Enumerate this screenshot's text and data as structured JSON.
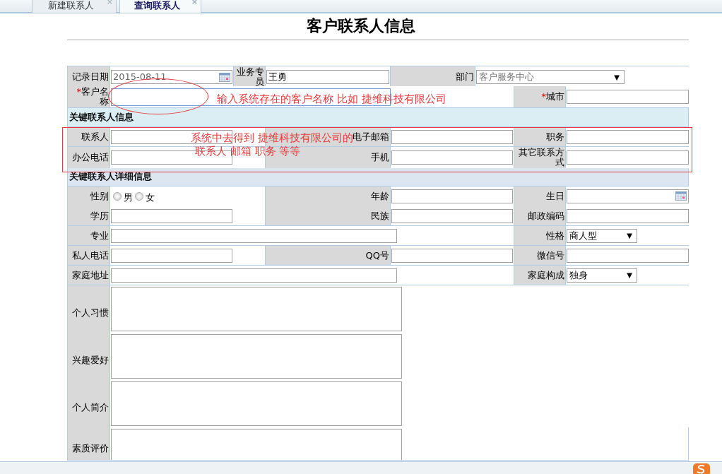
{
  "tabs": [
    {
      "label": "新建联系人",
      "selected": false,
      "close": "×"
    },
    {
      "label": "查询联系人",
      "selected": true,
      "close": "×"
    }
  ],
  "title": "客户联系人信息",
  "rows": [
    {
      "kind": "top",
      "cells": [
        {
          "label": "记录日期",
          "control": {
            "kind": "date",
            "value": "2015-08-11"
          }
        },
        {
          "label": "业务专员",
          "control": {
            "kind": "text",
            "value": "王勇"
          }
        },
        {
          "label": "部门",
          "control": {
            "kind": "select",
            "value": "客户服务中心",
            "caret": "▼",
            "disabled": true
          }
        }
      ]
    },
    {
      "kind": "fields",
      "cells": [
        {
          "label": "客户名称",
          "marker": "*",
          "control": {
            "kind": "text",
            "focused": true
          }
        },
        {
          "label": "城市",
          "marker": "*",
          "control": {
            "kind": "text"
          }
        }
      ]
    },
    {
      "kind": "section",
      "title": "关键联系人信息"
    },
    {
      "kind": "fields",
      "cells": [
        {
          "label": "联系人",
          "control": {
            "kind": "text"
          }
        },
        {
          "label": "电子邮箱",
          "control": {
            "kind": "text"
          }
        },
        {
          "label": "职务",
          "control": {
            "kind": "text"
          }
        }
      ]
    },
    {
      "kind": "fields",
      "cells": [
        {
          "label": "办公电话",
          "control": {
            "kind": "text"
          }
        },
        {
          "label": "手机",
          "control": {
            "kind": "text"
          }
        },
        {
          "label": "其它联系方式",
          "control": {
            "kind": "text"
          }
        }
      ]
    },
    {
      "kind": "section",
      "title": "关键联系人详细信息"
    },
    {
      "kind": "fields",
      "cells": [
        {
          "label": "性别",
          "control": {
            "kind": "radio",
            "options": [
              {
                "label": "男",
                "selected": false
              },
              {
                "label": "女",
                "selected": false
              }
            ]
          }
        },
        {
          "label": "年龄",
          "control": {
            "kind": "text"
          }
        },
        {
          "label": "生日",
          "control": {
            "kind": "date"
          }
        }
      ]
    },
    {
      "kind": "fields",
      "cells": [
        {
          "label": "学历",
          "control": {
            "kind": "text"
          }
        },
        {
          "label": "民族",
          "control": {
            "kind": "text"
          }
        },
        {
          "label": "邮政编码",
          "control": {
            "kind": "text"
          }
        }
      ]
    },
    {
      "kind": "fields",
      "cells": [
        {
          "label": "专业",
          "control": {
            "kind": "text"
          }
        },
        {
          "label": "性格",
          "control": {
            "kind": "select",
            "value": "商人型",
            "caret": "▼",
            "disabled": false
          }
        }
      ]
    },
    {
      "kind": "fields",
      "cells": [
        {
          "label": "私人电话",
          "control": {
            "kind": "text"
          }
        },
        {
          "label": "QQ号",
          "control": {
            "kind": "text"
          }
        },
        {
          "label": "微信号",
          "control": {
            "kind": "text"
          }
        }
      ]
    },
    {
      "kind": "fields",
      "cells": [
        {
          "label": "家庭地址",
          "control": {
            "kind": "text"
          }
        },
        {
          "label": "家庭构成",
          "control": {
            "kind": "select",
            "value": "独身",
            "caret": "▼",
            "disabled": false
          }
        }
      ]
    },
    {
      "kind": "area",
      "cells": [
        {
          "label": "个人习惯",
          "control": {
            "kind": "textarea"
          }
        }
      ]
    },
    {
      "kind": "area",
      "cells": [
        {
          "label": "兴趣爱好",
          "control": {
            "kind": "textarea"
          }
        }
      ]
    },
    {
      "kind": "area",
      "cells": [
        {
          "label": "个人简介",
          "control": {
            "kind": "textarea"
          }
        }
      ]
    },
    {
      "kind": "area",
      "cells": [
        {
          "label": "素质评价",
          "control": {
            "kind": "textarea"
          }
        }
      ]
    }
  ],
  "annotations": [
    {
      "kind": "ellipse"
    },
    {
      "kind": "note",
      "lines": [
        "输入系统存在的客户名称 比如 捷维科技有限公司"
      ]
    },
    {
      "kind": "box"
    },
    {
      "kind": "note",
      "lines": [
        "系统中去得到 捷维科技有限公司的",
        "联系人  邮箱 职务 等等"
      ]
    }
  ]
}
